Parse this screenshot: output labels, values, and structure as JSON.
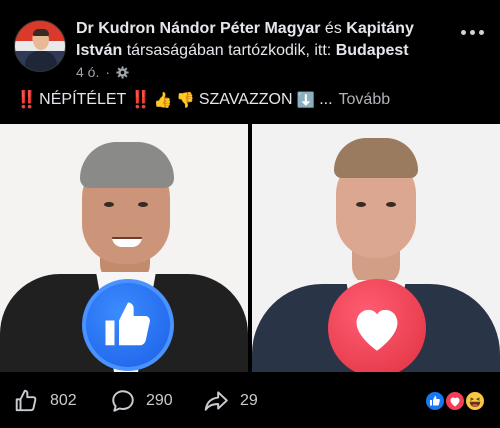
{
  "post": {
    "author_1": "Dr Kudron Nándor Péter Magyar",
    "connector": " és ",
    "author_2": "Kapitány",
    "author_2b": "István",
    "tagged_text": " társaságában tartózkodik, itt: ",
    "location": "Budapest",
    "time": "4 ó.",
    "meta_separator": "·",
    "privacy_icon": "gear-icon",
    "more_icon": "more-dots-icon"
  },
  "caption": {
    "prefix_bangs": "‼️",
    "word1": "NÉPÍTÉLET",
    "mid_bangs": "‼️",
    "emoji_up": "👍",
    "emoji_down": "👎",
    "word2": "SZAVAZZON",
    "emoji_arrow": "⬇️",
    "ellipsis": "...",
    "more_label": "Tovább"
  },
  "media": {
    "left_reaction": "like-reaction-icon",
    "right_reaction": "love-reaction-icon"
  },
  "footer": {
    "likes": "802",
    "comments": "290",
    "shares": "29",
    "reaction_icons": [
      "like-icon",
      "love-icon",
      "haha-icon"
    ]
  },
  "colors": {
    "background": "#000000",
    "like_blue": "#1877f2",
    "love_red": "#f33e58",
    "haha_yellow": "#f7c744",
    "text_primary": "#e4e6eb",
    "text_secondary": "#9ea3aa"
  }
}
